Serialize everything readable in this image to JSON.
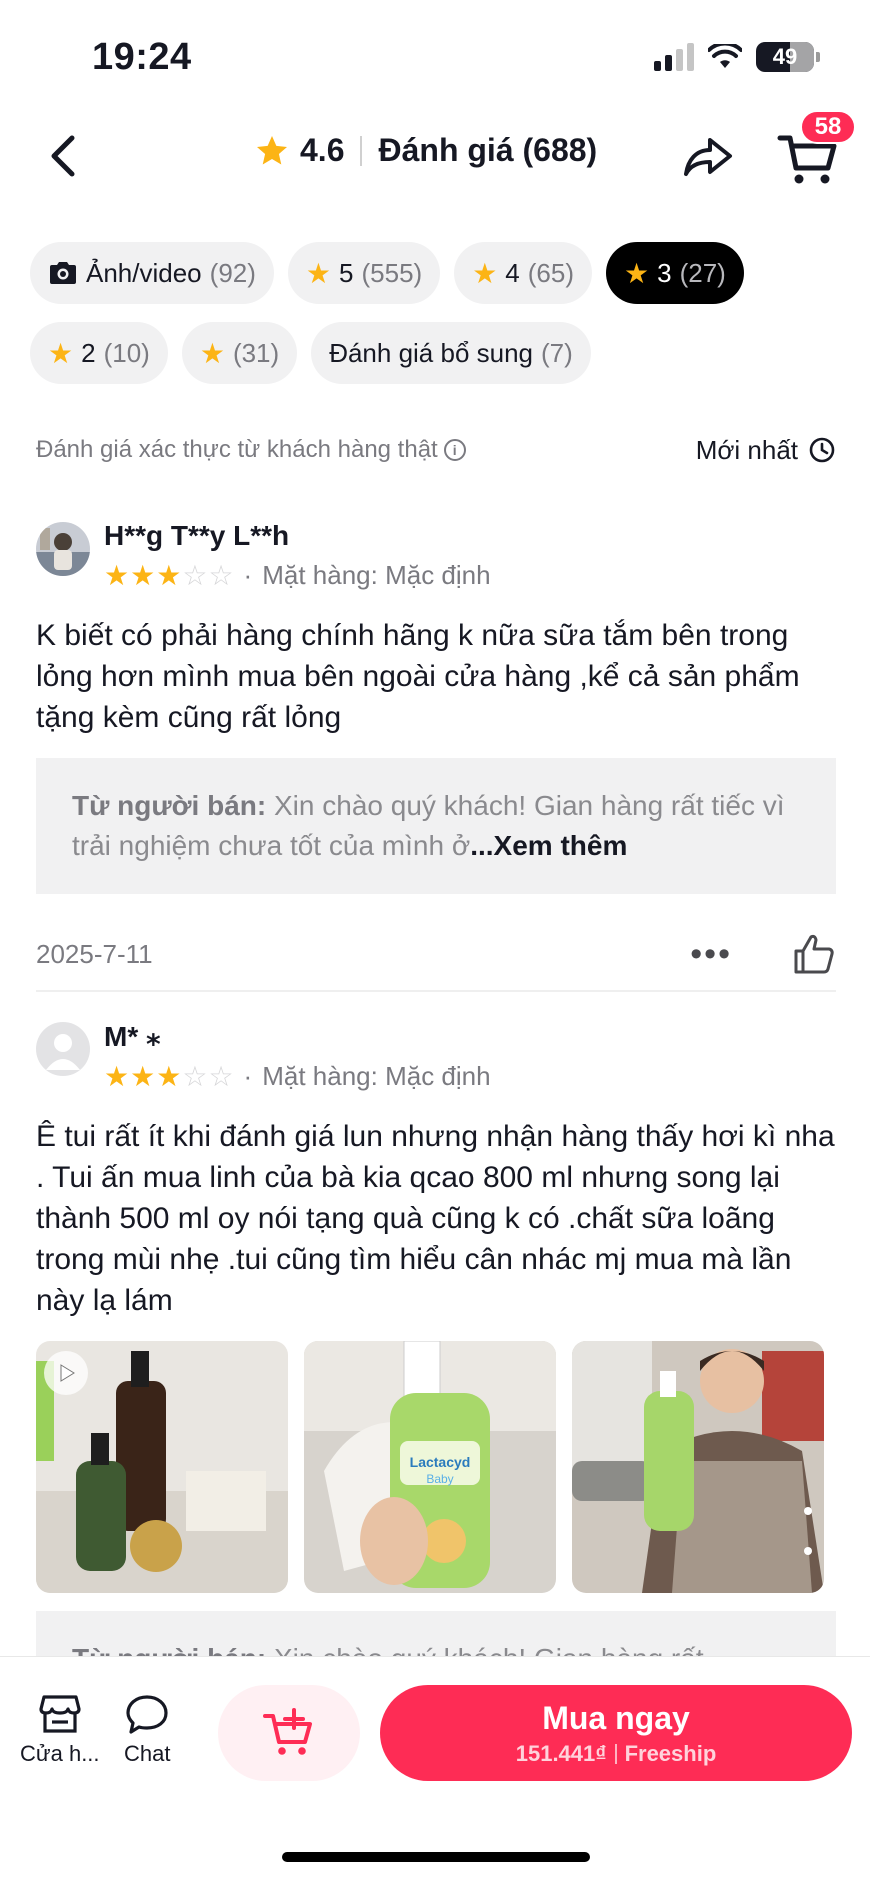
{
  "status": {
    "time": "19:24",
    "battery": "49"
  },
  "header": {
    "rating": "4.6",
    "title": "Đánh giá (688)",
    "cart_badge": "58"
  },
  "filters": [
    {
      "label": "Ảnh/video",
      "count": "(92)",
      "icon": "camera-icon",
      "active": false
    },
    {
      "label": "5",
      "count": "(555)",
      "icon": "star-icon",
      "active": false
    },
    {
      "label": "4",
      "count": "(65)",
      "icon": "star-icon",
      "active": false
    },
    {
      "label": "3",
      "count": "(27)",
      "icon": "star-icon",
      "active": true
    },
    {
      "label": "2",
      "count": "(10)",
      "icon": "star-icon",
      "active": false
    },
    {
      "label": "",
      "count": "(31)",
      "icon": "star-icon",
      "active": false
    },
    {
      "label": "Đánh giá bổ sung",
      "count": "(7)",
      "icon": "",
      "active": false
    }
  ],
  "sort": {
    "verified_text": "Đánh giá xác thực từ khách hàng thật",
    "sort_label": "Mới nhất"
  },
  "reviews": [
    {
      "name": "H**g T**y L**h",
      "rating": 3,
      "variant": "Mặt hàng: Mặc định",
      "text": "K biết có phải hàng chính hãng k nữa sữa tắm bên trong lỏng hơn mình mua bên ngoài cửa hàng ,kể cả sản phẩm tặng kèm cũng rất lỏng",
      "seller_label": "Từ người bán:",
      "seller_reply": "Xin chào quý khách! Gian hàng rất tiếc vì trải nghiệm chưa tốt của mình ở",
      "see_more": "...Xem thêm",
      "date": "2025-7-11"
    },
    {
      "name": "M* ⁎",
      "rating": 3,
      "variant": "Mặt hàng: Mặc định",
      "text": "Ê tui rất ít khi đánh giá lun nhưng nhận hàng thấy hơi kì nha . Tui ấn mua linh của bà kia qcao 800 ml nhưng song lại thành 500 ml oy nói tạng quà cũng k có .chất sữa loãng trong mùi nhẹ .tui cũng tìm hiểu cân nhác mj mua mà lần này lạ lám",
      "photo_product_text": "Lactacyd",
      "photo_product_sub": "Baby",
      "seller_label": "Từ người bán:",
      "seller_reply": "Xin chào quý khách! Gian hàng rất"
    }
  ],
  "bottom": {
    "store_label": "Cửa h...",
    "chat_label": "Chat",
    "buy_label": "Mua ngay",
    "price": "151.441₫",
    "shipping": "Freeship"
  },
  "colors": {
    "accent": "#fe2c55",
    "star": "#fcb415"
  }
}
